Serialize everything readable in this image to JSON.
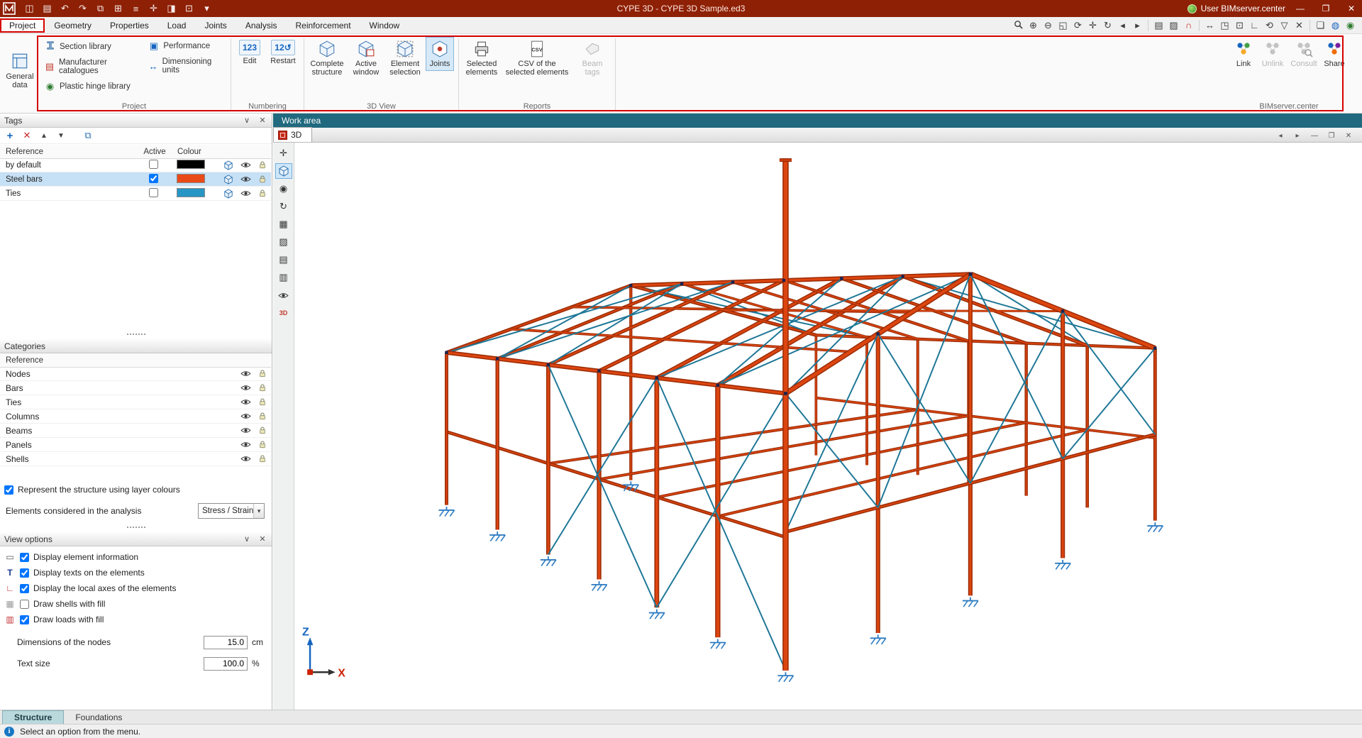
{
  "title_bar": {
    "title": "CYPE 3D - CYPE 3D Sample.ed3",
    "user": "User BIMserver.center",
    "window_controls": [
      "—",
      "❐",
      "✕"
    ]
  },
  "menu_bar": {
    "items": [
      "Project",
      "Geometry",
      "Properties",
      "Load",
      "Joints",
      "Analysis",
      "Reinforcement",
      "Window"
    ],
    "active_item": "Project"
  },
  "ribbon": {
    "general_data": {
      "line1": "General",
      "line2": "data"
    },
    "project": {
      "label": "Project",
      "items": [
        "Section library",
        "Manufacturer catalogues",
        "Plastic hinge library",
        "Performance",
        "Dimensioning units"
      ]
    },
    "numbering": {
      "label": "Numbering",
      "edit": "Edit",
      "restart": "Restart"
    },
    "view3d": {
      "label": "3D View",
      "complete": "Complete structure",
      "active": "Active window",
      "element": "Element selection",
      "joints": "Joints"
    },
    "reports": {
      "label": "Reports",
      "selected": "Selected elements",
      "csv": "CSV of the selected elements",
      "beam_tags": "Beam tags"
    },
    "bim": {
      "label": "BIMserver.center",
      "link": "Link",
      "unlink": "Unlink",
      "consult": "Consult",
      "share": "Share"
    }
  },
  "tags_panel": {
    "title": "Tags",
    "columns": {
      "reference": "Reference",
      "active": "Active",
      "colour": "Colour"
    },
    "rows": [
      {
        "reference": "by default",
        "colour": "#000000",
        "active": false
      },
      {
        "reference": "Steel bars",
        "colour": "#ea4a18",
        "active": true
      },
      {
        "reference": "Ties",
        "colour": "#2796c4",
        "active": false
      }
    ]
  },
  "categories_panel": {
    "title": "Categories",
    "header": "Reference",
    "rows": [
      "Nodes",
      "Bars",
      "Ties",
      "Columns",
      "Beams",
      "Panels",
      "Shells"
    ]
  },
  "options": {
    "layer_colours_label": "Represent the structure using layer colours",
    "layer_colours_checked": true,
    "analysis_label": "Elements considered in the analysis",
    "analysis_value": "Stress / Strain"
  },
  "view_options": {
    "title": "View options",
    "items": [
      {
        "label": "Display element information",
        "checked": true
      },
      {
        "label": "Display texts on the elements",
        "checked": true
      },
      {
        "label": "Display the local axes of the elements",
        "checked": true
      },
      {
        "label": "Draw shells with fill",
        "checked": false
      },
      {
        "label": "Draw loads with fill",
        "checked": true
      }
    ],
    "node_size_label": "Dimensions of the nodes",
    "node_size_value": "15.0",
    "node_size_unit": "cm",
    "text_size_label": "Text size",
    "text_size_value": "100.0",
    "text_size_unit": "%"
  },
  "bottom_tabs": {
    "structure": "Structure",
    "foundations": "Foundations"
  },
  "status_bar": {
    "message": "Select an option from the menu."
  },
  "work_area": {
    "title": "Work area",
    "tab_label": "3D",
    "window_controls": [
      "◂",
      "▸",
      "—",
      "❐",
      "✕"
    ]
  },
  "scene": {
    "axis_z": "Z",
    "axis_x": "X",
    "colors": {
      "steel": "#dc4510",
      "steel_dark": "#9a2b05",
      "ties": "#1d7696",
      "supports": "#2e7cc2",
      "nodes": "#1a2350"
    }
  },
  "glyphs": {
    "save": "◫",
    "print": "▤",
    "undo": "↶",
    "redo": "↷",
    "copy": "⧉",
    "grid": "⊞",
    "list": "≡",
    "move": "✛",
    "panel": "◨",
    "tools": "⊡",
    "dropdown": "▾",
    "zoom_in": "⊕",
    "zoom_out": "⊖",
    "zoom_window": "◱",
    "redraw": "⟳",
    "pan": "✛",
    "orbit": "↻",
    "prev": "◂",
    "next": "▸",
    "report": "▤",
    "texture": "▨",
    "magnet": "∩",
    "measure": "↔",
    "fullscreen": "◳",
    "scale": "⊡",
    "ortho": "∟",
    "refresh": "⟲",
    "filter": "▽",
    "erase": "✕",
    "windows": "❏",
    "globe": "◍",
    "sync": "◉",
    "chevron": "∨",
    "close": "✕",
    "plus": "+",
    "delete": "✕",
    "up": "▲",
    "down": "▼",
    "tag_edit": "⧉",
    "axes": "✛",
    "visibility": "◉",
    "rotate": "↻",
    "table": "▦",
    "chart": "▨",
    "grid2": "▤",
    "layers": "▥",
    "d3": "3D",
    "bubble": "▭",
    "text_t": "T",
    "local_axes": "∟",
    "shells": "▦",
    "loads": "▥",
    "info": "i",
    "num_edit": "123",
    "num_restart": "12↺",
    "csv": "CSV",
    "units": "↔",
    "performance": "▣",
    "plastic": "◉",
    "catalogue": "▤"
  }
}
